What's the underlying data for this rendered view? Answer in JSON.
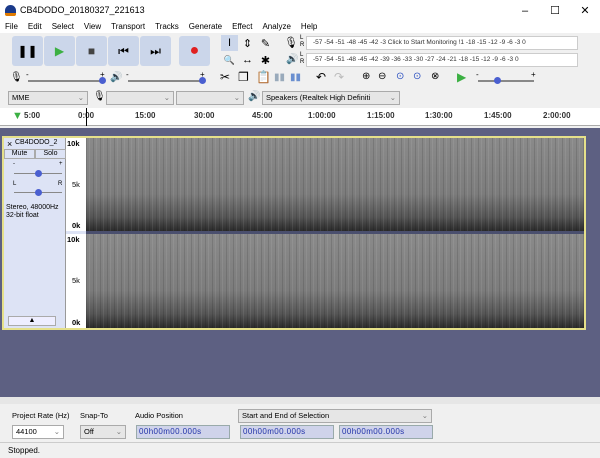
{
  "window": {
    "title": "CB4DODO_20180327_221613",
    "minimize": "–",
    "maximize": "☐",
    "close": "✕"
  },
  "menu": [
    "File",
    "Edit",
    "Select",
    "View",
    "Transport",
    "Tracks",
    "Generate",
    "Effect",
    "Analyze",
    "Help"
  ],
  "transport": {
    "pause": "❚❚",
    "play": "▶",
    "stop": "■",
    "skip_start": "⏮",
    "skip_end": "⏭",
    "record": "●"
  },
  "tools": {
    "select": "I",
    "envelope": "⇕",
    "draw": "✎",
    "zoom": "🔍",
    "timeshift": "↔",
    "multi": "✱"
  },
  "meters": {
    "rec_scale": "-57 -54 -51 -48 -45 -42 -3 Click to Start Monitoring !1 -18 -15 -12 -9 -6 -3 0",
    "play_scale": "-57 -54 -51 -48 -45 -42 -39 -36 -33 -30 -27 -24 -21 -18 -15 -12 -9 -6 -3 0",
    "L": "L",
    "R": "R"
  },
  "mixer": {
    "minus": "-",
    "plus": "+",
    "rec_volume": 0.98,
    "play_volume": 0.98,
    "play_speed": 0.35
  },
  "devices": {
    "host": "MME",
    "rec_device": "",
    "rec_channels": "",
    "play_device": "Speakers (Realtek High Definiti"
  },
  "timeline": {
    "labels": [
      "5:00",
      "0:00",
      "15:00",
      "30:00",
      "45:00",
      "1:00:00",
      "1:15:00",
      "1:30:00",
      "1:45:00",
      "2:00:00"
    ]
  },
  "track": {
    "name": "CB4DODO_2",
    "close": "×",
    "mute": "Mute",
    "solo": "Solo",
    "gain_minus": "-",
    "gain_plus": "+",
    "pan_l": "L",
    "pan_r": "R",
    "info1": "Stereo, 48000Hz",
    "info2": "32-bit float",
    "collapse": "▲",
    "ruler": [
      "10k",
      "5k",
      "0k"
    ]
  },
  "selection_bar": {
    "rate_label": "Project Rate (Hz)",
    "rate": "44100",
    "snap_label": "Snap-To",
    "snap": "Off",
    "pos_label": "Audio Position",
    "pos": "00h00m00.000s",
    "sel_label": "Start and End of Selection",
    "sel_start": "00h00m00.000s",
    "sel_end": "00h00m00.000s"
  },
  "status": "Stopped.",
  "colors": {
    "track_bg": "#5d6082",
    "button": "#cbd6ea",
    "selection_border": "#e5e08a"
  }
}
